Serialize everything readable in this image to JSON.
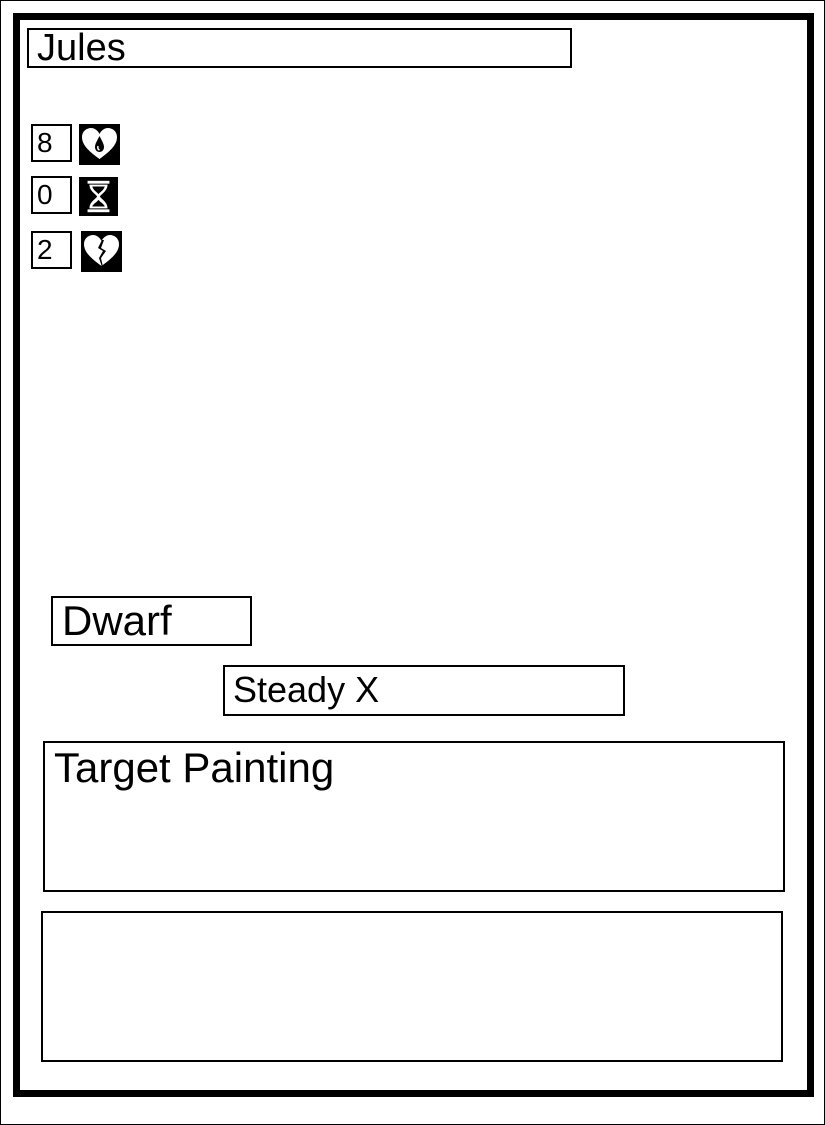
{
  "card": {
    "name": "Jules",
    "stats": [
      {
        "value": "8",
        "icon": "heart-drop-icon"
      },
      {
        "value": "0",
        "icon": "hourglass-icon"
      },
      {
        "value": "2",
        "icon": "broken-heart-icon"
      }
    ],
    "race": "Dwarf",
    "ability": "Steady X",
    "text_primary": "Target Painting",
    "text_secondary": ""
  }
}
